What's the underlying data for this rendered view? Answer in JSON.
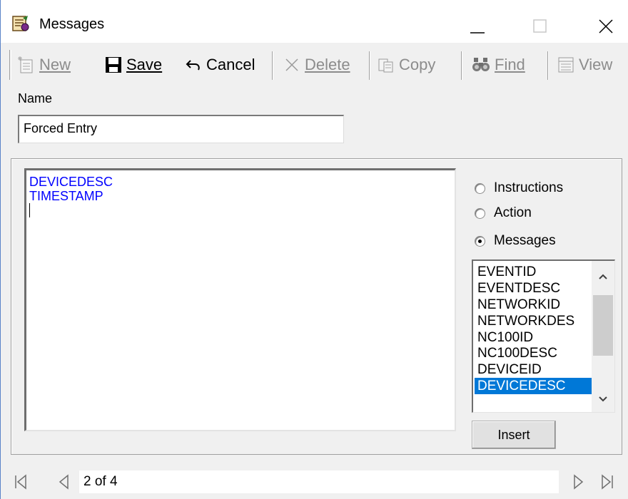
{
  "window": {
    "title": "Messages",
    "icon": "messages-app-icon"
  },
  "toolbar": {
    "new_label": "New",
    "save_label": "Save",
    "cancel_label": "Cancel",
    "delete_label": "Delete",
    "copy_label": "Copy",
    "find_label": "Find",
    "view_label": "View"
  },
  "form": {
    "name_label": "Name",
    "name_value": "Forced Entry"
  },
  "editor": {
    "lines": [
      "DEVICEDESC",
      "TIMESTAMP"
    ],
    "text_color": "#0000ff"
  },
  "mode": {
    "options": [
      "Instructions",
      "Action",
      "Messages"
    ],
    "selected": "Messages"
  },
  "fields_list": {
    "items": [
      "EVENTID",
      "EVENTDESC",
      "NETWORKID",
      "NETWORKDES",
      "NC100ID",
      "NC100DESC",
      "DEVICEID",
      "DEVICEDESC"
    ],
    "selected": "DEVICEDESC",
    "selection_color": "#0078d7"
  },
  "insert_label": "Insert",
  "navigator": {
    "record_text": "2 of 4"
  }
}
